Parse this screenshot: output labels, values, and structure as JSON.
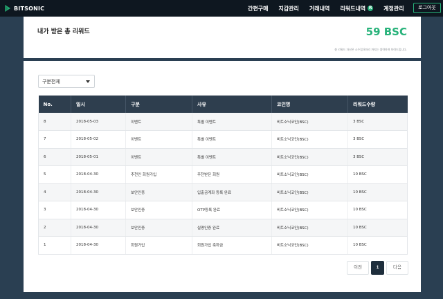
{
  "brand": {
    "name": "BITSONIC",
    "accent": "#27b27a",
    "nav_bg": "#0e1720",
    "header_bg": "#2e3e4e"
  },
  "nav": {
    "items": [
      {
        "label": "간편구매"
      },
      {
        "label": "지갑관리"
      },
      {
        "label": "거래내역"
      },
      {
        "label": "리워드내역",
        "badge": "R"
      },
      {
        "label": "계정관리"
      }
    ],
    "logout": "로그아웃"
  },
  "summary": {
    "title": "내가 받은 총 리워드",
    "value": "59 BSC",
    "note": "총 리워드 자산은 소수점 8자리 까지는 생략하여 보여드립니다."
  },
  "filter": {
    "selected": "구분전체"
  },
  "table": {
    "columns": [
      "No.",
      "일시",
      "구분",
      "사유",
      "코인명",
      "리워드수량"
    ],
    "rows": [
      [
        "8",
        "2018-05-03",
        "이벤트",
        "특별 이벤트",
        "비트소닉코인(BSC)",
        "3 BSC"
      ],
      [
        "7",
        "2018-05-02",
        "이벤트",
        "특별 이벤트",
        "비트소닉코인(BSC)",
        "3 BSC"
      ],
      [
        "6",
        "2018-05-01",
        "이벤트",
        "특별 이벤트",
        "비트소닉코인(BSC)",
        "3 BSC"
      ],
      [
        "5",
        "2018-04-30",
        "추천인 회원가입",
        "추천받은 회원",
        "비트소닉코인(BSC)",
        "10 BSC"
      ],
      [
        "4",
        "2018-04-30",
        "보안인증",
        "입출금계좌 등록 완료",
        "비트소닉코인(BSC)",
        "10 BSC"
      ],
      [
        "3",
        "2018-04-30",
        "보안인증",
        "OTP등록 완료",
        "비트소닉코인(BSC)",
        "10 BSC"
      ],
      [
        "2",
        "2018-04-30",
        "보안인증",
        "실명인증 완료",
        "비트소닉코인(BSC)",
        "10 BSC"
      ],
      [
        "1",
        "2018-04-30",
        "회원가입",
        "회원가입 축하금",
        "비트소닉코인(BSC)",
        "10 BSC"
      ]
    ]
  },
  "pagination": {
    "prev": "이전",
    "current": "1",
    "next": "다음"
  }
}
